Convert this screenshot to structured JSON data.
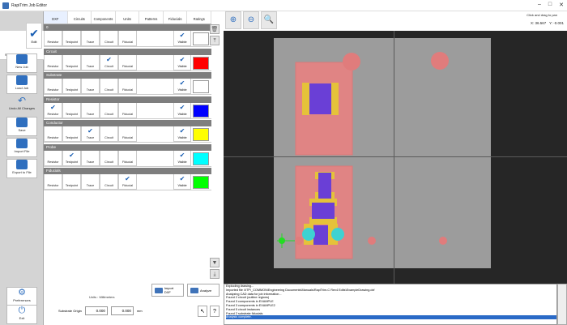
{
  "window": {
    "title": "RapiTrim Job Editor"
  },
  "sidebar": {
    "settings_label": "Settings",
    "edit_label": "Edit",
    "new_job": "New Job",
    "load_job": "Load Job",
    "undo_all": "Undo All Changes",
    "save": "Save",
    "import_file": "Import File",
    "export_file": "Export to File",
    "preferences": "Preferences",
    "exit": "Exit"
  },
  "tabs": [
    "DXF",
    "Circuits",
    "Components",
    "Units",
    "Patterns",
    "Fiducials",
    "Ratings"
  ],
  "columns": [
    "Resistor",
    "Testpoint",
    "Trace",
    "Circuit",
    "Fiducial"
  ],
  "visible_label": "Visible",
  "layers": [
    {
      "name": "0",
      "checks": [
        false,
        false,
        false,
        false,
        false
      ],
      "visible": true,
      "color": "#ffffff"
    },
    {
      "name": "Circuit",
      "checks": [
        false,
        false,
        false,
        true,
        false
      ],
      "visible": true,
      "color": "#ff0000"
    },
    {
      "name": "Substrate",
      "checks": [
        false,
        false,
        false,
        false,
        false
      ],
      "visible": true,
      "color": "#ffffff"
    },
    {
      "name": "Resistor",
      "checks": [
        true,
        false,
        false,
        false,
        false
      ],
      "visible": true,
      "color": "#0000ff"
    },
    {
      "name": "Conductor",
      "checks": [
        false,
        false,
        true,
        false,
        false
      ],
      "visible": true,
      "color": "#ffff00"
    },
    {
      "name": "Probe",
      "checks": [
        false,
        true,
        false,
        false,
        false
      ],
      "visible": true,
      "color": "#00ffff"
    },
    {
      "name": "Fiducials",
      "checks": [
        false,
        false,
        false,
        false,
        true
      ],
      "visible": true,
      "color": "#00ff00"
    }
  ],
  "units_label": "Units : Millimeters",
  "import_dxf": "Import DXF",
  "analyze": "Analyze",
  "origin": {
    "label": "Substrate Origin",
    "x": "0.000",
    "y": "0.000",
    "unit": "mm"
  },
  "toolbar": {
    "hint": "Click and drag to pan",
    "x_coord": "X: 36.567",
    "y_coord": "Y: -0.001"
  },
  "log": [
    "Exploding drawing...",
    "Imported file \\\\ITP\\_COMMON\\Engineering Documents\\Manuals\\RapiTrim-C Rev4 Edits\\ExampleDrawing.dxf",
    "Analyzing CAD data for job information...",
    "Found 2 circuit (outline regions)",
    "Found 3 components in EXAMPLE",
    "Found 3 components in EXAMPLE2",
    "Found 5 circuit instances",
    "Found 2 substrate fiducials",
    "Analysis complete."
  ]
}
